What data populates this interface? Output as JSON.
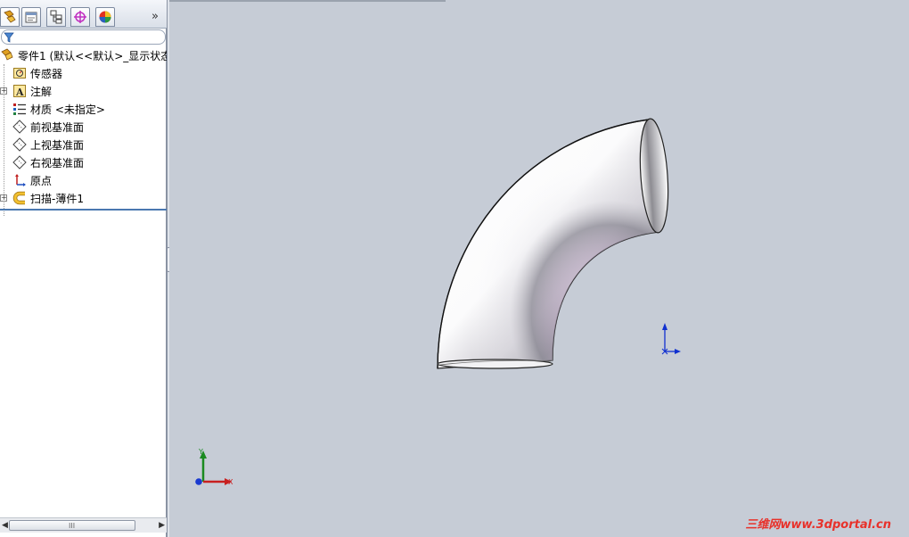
{
  "tabs": [
    {
      "name": "feature-manager",
      "icon": "feature-manager-icon"
    },
    {
      "name": "property-manager",
      "icon": "property-manager-icon"
    },
    {
      "name": "configuration-manager",
      "icon": "configuration-manager-icon"
    },
    {
      "name": "dim-xpert",
      "icon": "dimxpert-icon"
    },
    {
      "name": "display-manager",
      "icon": "display-manager-icon"
    }
  ],
  "tab_more_label": "»",
  "tree": {
    "root_label": "零件1 (默认<<默认>_显示状态",
    "items": [
      {
        "label": "传感器",
        "icon": "sensor-icon",
        "expandable": false
      },
      {
        "label": "注解",
        "icon": "annotation-icon",
        "expandable": true
      },
      {
        "label": "材质 <未指定>",
        "icon": "material-icon",
        "expandable": false
      },
      {
        "label": "前视基准面",
        "icon": "plane-icon",
        "expandable": false
      },
      {
        "label": "上视基准面",
        "icon": "plane-icon",
        "expandable": false
      },
      {
        "label": "右视基准面",
        "icon": "plane-icon",
        "expandable": false
      },
      {
        "label": "原点",
        "icon": "origin-icon",
        "expandable": false
      },
      {
        "label": "扫描-薄件1",
        "icon": "sweep-thin-icon",
        "expandable": true
      }
    ]
  },
  "scrollbar_grip": "III",
  "triad": {
    "x_label": "X",
    "y_label": "Y"
  },
  "watermark": "三维网www.3dportal.cn",
  "colors": {
    "viewport_bg": "#c6ccd6",
    "accent": "#4a78b0",
    "watermark": "#e8312a"
  }
}
